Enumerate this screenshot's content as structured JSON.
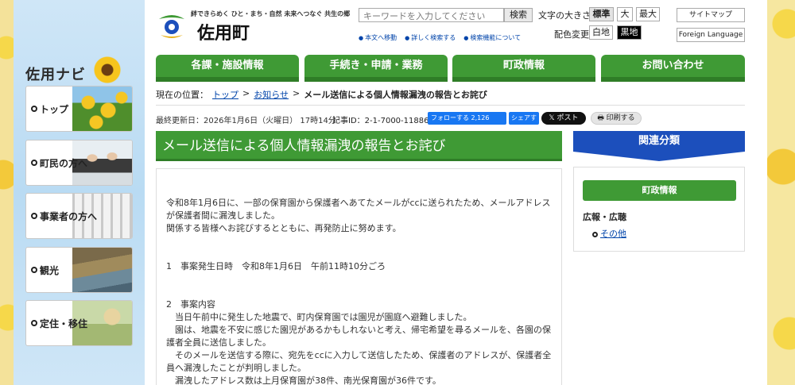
{
  "header": {
    "tagline": "絆できらめく ひと・まち・自然 未来へつなぐ 共生の郷",
    "city_name": "佐用町",
    "search": {
      "placeholder": "キーワードを入力してください",
      "button": "検索"
    },
    "sub_links": [
      "本文へ移動",
      "詳しく検索する",
      "検索機能について"
    ],
    "font_size": {
      "label": "文字の大きさ",
      "options": [
        "標準",
        "大",
        "最大"
      ],
      "selected": "標準"
    },
    "color_change": {
      "label": "配色変更",
      "options": [
        "白地",
        "黒地"
      ]
    },
    "sitemap": "サイトマップ",
    "foreign_language": "Foreign Language"
  },
  "main_nav": [
    "各課・施設情報",
    "手続き・申請・業務",
    "町政情報",
    "お問い合わせ"
  ],
  "left_nav": {
    "title": "佐用ナビ",
    "items": [
      "トップ",
      "町民の方へ",
      "事業者の方へ",
      "観光",
      "定住・移住"
    ]
  },
  "breadcrumb": {
    "prefix": "現在の位置：",
    "links": [
      "トップ",
      "お知らせ"
    ],
    "separator": ">",
    "current": "メール送信による個人情報漏洩の報告とお詫び"
  },
  "meta": {
    "updated": "最終更新日：2026年1月6日（火曜日） 17時14分",
    "article_id": "記事ID：2-1-7000-11886",
    "fb_follow": "フォローする 2,126",
    "fb_share": "シェアする",
    "x_post": "ポスト",
    "print": "印刷する"
  },
  "article": {
    "title": "メール送信による個人情報漏洩の報告とお詫び",
    "p1": "令和8年1月6日に、一部の保育園から保護者へあてたメールがccに送られたため、メールアドレスが保護者間に漏洩しました。",
    "p2": "関係する皆様へお詫びするとともに、再発防止に努めます。",
    "s1": "1　事案発生日時　令和8年1月6日　午前11時10分ごろ",
    "s2": "2　事案内容",
    "c1": "　当日午前中に発生した地震で、町内保育園では園児が園庭へ避難しました。",
    "c2": "　園は、地震を不安に感じた園児があるかもしれないと考え、帰宅希望を尋るメールを、各園の保護者全員に送信しました。",
    "c3": "　そのメールを送信する際に、宛先をccに入力して送信したため、保護者のアドレスが、保護者全員へ漏洩したことが判明しました。",
    "c4": "　漏洩したアドレス数は上月保育園が38件、南光保育園が36件です。"
  },
  "related": {
    "title": "関連分類",
    "category": "町政情報",
    "subcategory": "広報・広聴",
    "link": "その他"
  },
  "colors": {
    "green": "#3f9a35",
    "blue": "#1c4fbc",
    "link": "#0044aa"
  }
}
